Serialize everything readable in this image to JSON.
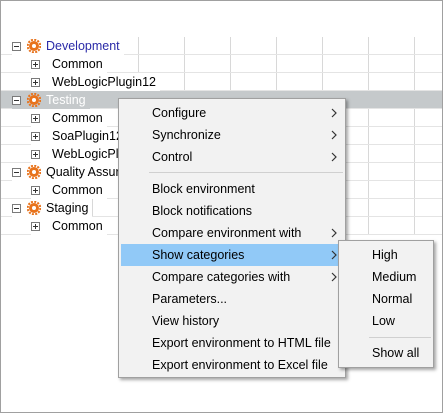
{
  "tree": {
    "items": [
      {
        "label": "Development",
        "expanded": true,
        "style": "link"
      },
      {
        "label": "Common",
        "child": true
      },
      {
        "label": "WebLogicPlugin12",
        "child": true
      },
      {
        "label": "Testing",
        "expanded": true,
        "style": "selected"
      },
      {
        "label": "Common",
        "child": true
      },
      {
        "label": "SoaPlugin12",
        "child": true
      },
      {
        "label": "WebLogicPlu",
        "child": true
      },
      {
        "label": "Quality Assur",
        "expanded": true,
        "style": "normal"
      },
      {
        "label": "Common",
        "child": true
      },
      {
        "label": "Staging",
        "expanded": true,
        "style": "normal"
      },
      {
        "label": "Common",
        "child": true
      }
    ]
  },
  "context_menu": {
    "items": [
      {
        "label": "Configure",
        "submenu": true
      },
      {
        "label": "Synchronize",
        "submenu": true
      },
      {
        "label": "Control",
        "submenu": true
      },
      {
        "label": "Block environment",
        "submenu": false
      },
      {
        "label": "Block notifications",
        "submenu": false
      },
      {
        "label": "Compare environment with",
        "submenu": true
      },
      {
        "label": "Show categories",
        "submenu": true,
        "highlighted": true
      },
      {
        "label": "Compare categories with",
        "submenu": true
      },
      {
        "label": "Parameters...",
        "submenu": false
      },
      {
        "label": "View history",
        "submenu": false
      },
      {
        "label": "Export environment to HTML file",
        "submenu": false
      },
      {
        "label": "Export environment to Excel file",
        "submenu": false
      }
    ]
  },
  "submenu": {
    "items": [
      {
        "label": "High"
      },
      {
        "label": "Medium"
      },
      {
        "label": "Normal"
      },
      {
        "label": "Low"
      },
      {
        "label": "Show all"
      }
    ]
  },
  "colors": {
    "gear": "#e8731c",
    "link": "#2a2aa8",
    "selection_row": "#c5c9cb",
    "menu_highlight": "#91c9f7"
  }
}
